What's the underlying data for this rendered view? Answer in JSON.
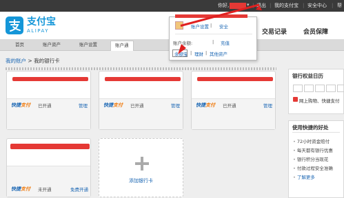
{
  "topbar": {
    "greeting": "你好,",
    "logout": "退出",
    "my_alipay": "我的支付宝",
    "security_center": "安全中心",
    "help": "帮"
  },
  "header": {
    "logo_cn": "支付宝",
    "logo_en": "ALIPAY",
    "nav": [
      "交易记录",
      "会员保障"
    ]
  },
  "subnav": {
    "tabs": [
      "首页",
      "账户资产",
      "账户设置",
      "账户通"
    ]
  },
  "popup": {
    "account_settings": "账户设置",
    "account_security": "安全",
    "balance_label": "账户余额:",
    "balance_value": "",
    "recharge": "充值",
    "yuebao": "余额宝",
    "licai": "理财",
    "other_assets": "其他资产"
  },
  "breadcrumb": {
    "root": "我的账户",
    "arrow": ">",
    "current": "我的银行卡"
  },
  "cards": [
    {
      "quick": "快捷",
      "quick2": "支付",
      "status": "已开通",
      "action": "管理"
    },
    {
      "quick": "快捷",
      "quick2": "支付",
      "status": "已开通",
      "action": "管理"
    },
    {
      "quick": "快捷",
      "quick2": "支付",
      "status": "已开通",
      "action": "管理"
    },
    {
      "quick": "快捷",
      "quick2": "支付",
      "status": "未开通",
      "action": "免费开通"
    }
  ],
  "add_card": {
    "label": "添加银行卡"
  },
  "calendar_panel": {
    "title": "银行权益日历",
    "note": "网上购物、快捷支付"
  },
  "benefits_panel": {
    "title": "使用快捷的好处",
    "items": [
      "72小时资金赔付",
      "每天都有银行优惠",
      "银行积分当现花",
      "付款过程安全准确",
      "了解更多"
    ]
  },
  "colors": {
    "brand_blue": "#1496d8",
    "link_blue": "#1a66b3",
    "annotation_red": "#e02020"
  }
}
